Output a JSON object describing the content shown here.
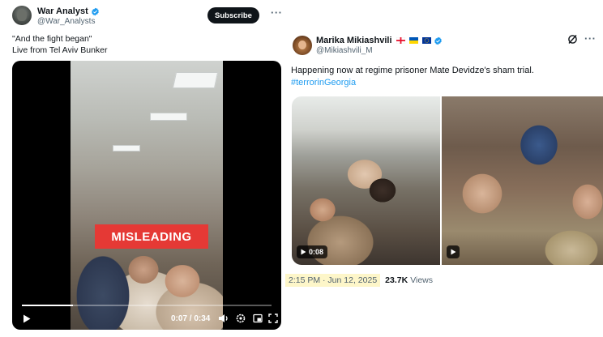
{
  "left_post": {
    "display_name": "War Analyst",
    "handle": "@War_Analysts",
    "subscribe_label": "Subscribe",
    "text_line1": "\"And the fight began\"",
    "text_line2": "Live from Tel Aviv Bunker",
    "badge_label": "MISLEADING",
    "video_time": "0:07 / 0:34",
    "video_progress_fraction": 0.206
  },
  "right_post": {
    "display_name": "Marika Mikiashvili",
    "handle": "@Mikiashvili_M",
    "text": "Happening now at regime prisoner Mate Devidze's sham trial.",
    "hashtag": "#terrorinGeorgia",
    "video_duration": "0:08",
    "timestamp": "2:15 PM · Jun 12, 2025",
    "views_count": "23.7K",
    "views_label": "Views"
  },
  "colors": {
    "verified_blue": "#1d9bf0",
    "link_blue": "#1d9bf0",
    "badge_red": "#e53935",
    "highlight": "#fdf6c9"
  },
  "icons": [
    "verified-icon",
    "more-icon",
    "grok-icon",
    "play-icon",
    "volume-icon",
    "settings-icon",
    "fullscreen-icon",
    "pip-icon",
    "georgia-flag-icon",
    "ukraine-flag-icon",
    "eu-flag-icon"
  ]
}
